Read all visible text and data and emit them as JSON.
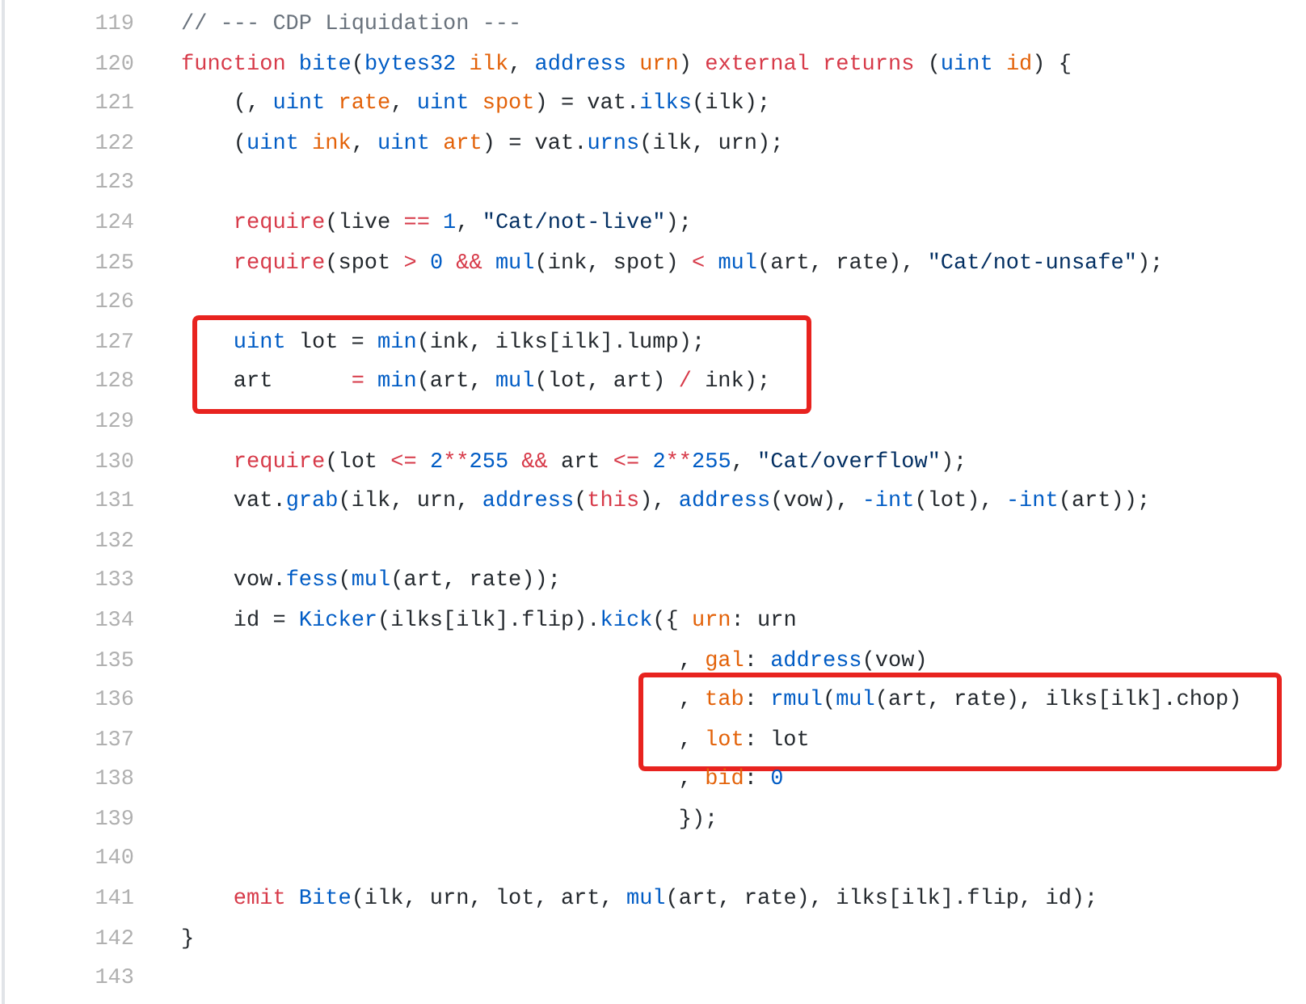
{
  "blocks": [
    {
      "highlighted": false,
      "lines": [
        {
          "number": "119",
          "tokens": [
            {
              "kind": "comment",
              "text": "// --- CDP Liquidation ---"
            }
          ]
        },
        {
          "number": "120",
          "tokens": [
            {
              "kind": "keyword",
              "text": "function "
            },
            {
              "kind": "function",
              "text": "bite"
            },
            {
              "kind": "plain",
              "text": "("
            },
            {
              "kind": "type",
              "text": "bytes32 "
            },
            {
              "kind": "param",
              "text": "ilk"
            },
            {
              "kind": "plain",
              "text": ", "
            },
            {
              "kind": "type",
              "text": "address "
            },
            {
              "kind": "param",
              "text": "urn"
            },
            {
              "kind": "plain",
              "text": ") "
            },
            {
              "kind": "keyword",
              "text": "external returns"
            },
            {
              "kind": "plain",
              "text": " ("
            },
            {
              "kind": "type",
              "text": "uint "
            },
            {
              "kind": "param",
              "text": "id"
            },
            {
              "kind": "plain",
              "text": ") {"
            }
          ]
        },
        {
          "number": "121",
          "tokens": [
            {
              "kind": "plain",
              "text": "    (, "
            },
            {
              "kind": "type",
              "text": "uint "
            },
            {
              "kind": "param",
              "text": "rate"
            },
            {
              "kind": "plain",
              "text": ", "
            },
            {
              "kind": "type",
              "text": "uint "
            },
            {
              "kind": "param",
              "text": "spot"
            },
            {
              "kind": "plain",
              "text": ") = vat."
            },
            {
              "kind": "function",
              "text": "ilks"
            },
            {
              "kind": "plain",
              "text": "(ilk);"
            }
          ]
        },
        {
          "number": "122",
          "tokens": [
            {
              "kind": "plain",
              "text": "    ("
            },
            {
              "kind": "type",
              "text": "uint "
            },
            {
              "kind": "param",
              "text": "ink"
            },
            {
              "kind": "plain",
              "text": ", "
            },
            {
              "kind": "type",
              "text": "uint "
            },
            {
              "kind": "param",
              "text": "art"
            },
            {
              "kind": "plain",
              "text": ") = vat."
            },
            {
              "kind": "function",
              "text": "urns"
            },
            {
              "kind": "plain",
              "text": "(ilk, urn);"
            }
          ]
        },
        {
          "number": "123"
        },
        {
          "number": "124",
          "tokens": [
            {
              "kind": "keyword",
              "text": "    require"
            },
            {
              "kind": "plain",
              "text": "(live "
            },
            {
              "kind": "operator",
              "text": "== "
            },
            {
              "kind": "number",
              "text": "1"
            },
            {
              "kind": "plain",
              "text": ", "
            },
            {
              "kind": "string",
              "text": "\"Cat/not-live\""
            },
            {
              "kind": "plain",
              "text": ");"
            }
          ]
        },
        {
          "number": "125",
          "tokens": [
            {
              "kind": "keyword",
              "text": "    require"
            },
            {
              "kind": "plain",
              "text": "(spot "
            },
            {
              "kind": "operator",
              "text": "> "
            },
            {
              "kind": "number",
              "text": "0 "
            },
            {
              "kind": "operator",
              "text": "&& "
            },
            {
              "kind": "function",
              "text": "mul"
            },
            {
              "kind": "plain",
              "text": "(ink, spot) "
            },
            {
              "kind": "operator",
              "text": "< "
            },
            {
              "kind": "function",
              "text": "mul"
            },
            {
              "kind": "plain",
              "text": "(art, rate), "
            },
            {
              "kind": "string",
              "text": "\"Cat/not-unsafe\""
            },
            {
              "kind": "plain",
              "text": ");"
            }
          ]
        },
        {
          "number": "126"
        }
      ]
    },
    {
      "highlighted": true,
      "lines": [
        {
          "number": "127",
          "tokens": [
            {
              "kind": "type",
              "text": "    uint"
            },
            {
              "kind": "plain",
              "text": " lot = "
            },
            {
              "kind": "function",
              "text": "min"
            },
            {
              "kind": "plain",
              "text": "(ink, ilks[ilk].lump);"
            }
          ]
        },
        {
          "number": "128",
          "tokens": [
            {
              "kind": "plain",
              "text": "    art      "
            },
            {
              "kind": "operator",
              "text": "= "
            },
            {
              "kind": "function",
              "text": "min"
            },
            {
              "kind": "plain",
              "text": "(art, "
            },
            {
              "kind": "function",
              "text": "mul"
            },
            {
              "kind": "plain",
              "text": "(lot, art) "
            },
            {
              "kind": "operator",
              "text": "/"
            },
            {
              "kind": "plain",
              "text": " ink);"
            }
          ]
        }
      ]
    },
    {
      "highlighted": false,
      "lines": [
        {
          "number": "129"
        },
        {
          "number": "130",
          "tokens": [
            {
              "kind": "keyword",
              "text": "    require"
            },
            {
              "kind": "plain",
              "text": "(lot "
            },
            {
              "kind": "operator",
              "text": "<= "
            },
            {
              "kind": "number",
              "text": "2"
            },
            {
              "kind": "operator",
              "text": "**"
            },
            {
              "kind": "number",
              "text": "255 "
            },
            {
              "kind": "operator",
              "text": "&&"
            },
            {
              "kind": "plain",
              "text": " art "
            },
            {
              "kind": "operator",
              "text": "<= "
            },
            {
              "kind": "number",
              "text": "2"
            },
            {
              "kind": "operator",
              "text": "**"
            },
            {
              "kind": "number",
              "text": "255"
            },
            {
              "kind": "plain",
              "text": ", "
            },
            {
              "kind": "string",
              "text": "\"Cat/overflow\""
            },
            {
              "kind": "plain",
              "text": ");"
            }
          ]
        },
        {
          "number": "131",
          "tokens": [
            {
              "kind": "plain",
              "text": "    vat."
            },
            {
              "kind": "function",
              "text": "grab"
            },
            {
              "kind": "plain",
              "text": "(ilk, urn, "
            },
            {
              "kind": "type",
              "text": "address"
            },
            {
              "kind": "plain",
              "text": "("
            },
            {
              "kind": "keyword",
              "text": "this"
            },
            {
              "kind": "plain",
              "text": "), "
            },
            {
              "kind": "type",
              "text": "address"
            },
            {
              "kind": "plain",
              "text": "(vow), "
            },
            {
              "kind": "type",
              "text": "-int"
            },
            {
              "kind": "plain",
              "text": "(lot), "
            },
            {
              "kind": "type",
              "text": "-int"
            },
            {
              "kind": "plain",
              "text": "(art));"
            }
          ]
        },
        {
          "number": "132"
        },
        {
          "number": "133",
          "tokens": [
            {
              "kind": "plain",
              "text": "    vow."
            },
            {
              "kind": "function",
              "text": "fess"
            },
            {
              "kind": "plain",
              "text": "("
            },
            {
              "kind": "function",
              "text": "mul"
            },
            {
              "kind": "plain",
              "text": "(art, rate));"
            }
          ]
        },
        {
          "number": "134",
          "tokens": [
            {
              "kind": "plain",
              "text": "    id = "
            },
            {
              "kind": "function",
              "text": "Kicker"
            },
            {
              "kind": "plain",
              "text": "(ilks[ilk].flip)."
            },
            {
              "kind": "function",
              "text": "kick"
            },
            {
              "kind": "plain",
              "text": "({ "
            },
            {
              "kind": "param",
              "text": "urn"
            },
            {
              "kind": "plain",
              "text": ": urn"
            }
          ]
        },
        {
          "number": "135",
          "tokens": [
            {
              "kind": "plain",
              "text": "                                      , "
            },
            {
              "kind": "param",
              "text": "gal"
            },
            {
              "kind": "plain",
              "text": ": "
            },
            {
              "kind": "type",
              "text": "address"
            },
            {
              "kind": "plain",
              "text": "(vow)"
            }
          ]
        }
      ]
    },
    {
      "highlighted": true,
      "lines": [
        {
          "number": "136",
          "tokens": [
            {
              "kind": "plain",
              "text": "                                      , "
            },
            {
              "kind": "param",
              "text": "tab"
            },
            {
              "kind": "plain",
              "text": ": "
            },
            {
              "kind": "function",
              "text": "rmul"
            },
            {
              "kind": "plain",
              "text": "("
            },
            {
              "kind": "function",
              "text": "mul"
            },
            {
              "kind": "plain",
              "text": "(art, rate), ilks[ilk].chop)"
            }
          ]
        },
        {
          "number": "137",
          "tokens": [
            {
              "kind": "plain",
              "text": "                                      , "
            },
            {
              "kind": "param",
              "text": "lot"
            },
            {
              "kind": "plain",
              "text": ": lot"
            }
          ]
        }
      ]
    },
    {
      "highlighted": false,
      "lines": [
        {
          "number": "138",
          "tokens": [
            {
              "kind": "plain",
              "text": "                                      , "
            },
            {
              "kind": "param",
              "text": "bid"
            },
            {
              "kind": "plain",
              "text": ": "
            },
            {
              "kind": "number",
              "text": "0"
            }
          ]
        },
        {
          "number": "139",
          "tokens": [
            {
              "kind": "plain",
              "text": "                                      });"
            }
          ]
        },
        {
          "number": "140"
        },
        {
          "number": "141",
          "tokens": [
            {
              "kind": "keyword",
              "text": "    emit "
            },
            {
              "kind": "function",
              "text": "Bite"
            },
            {
              "kind": "plain",
              "text": "(ilk, urn, lot, art, "
            },
            {
              "kind": "function",
              "text": "mul"
            },
            {
              "kind": "plain",
              "text": "(art, rate), ilks[ilk].flip, id);"
            }
          ]
        },
        {
          "number": "142",
          "tokens": [
            {
              "kind": "plain",
              "text": "}"
            }
          ]
        },
        {
          "number": "143"
        }
      ]
    }
  ]
}
